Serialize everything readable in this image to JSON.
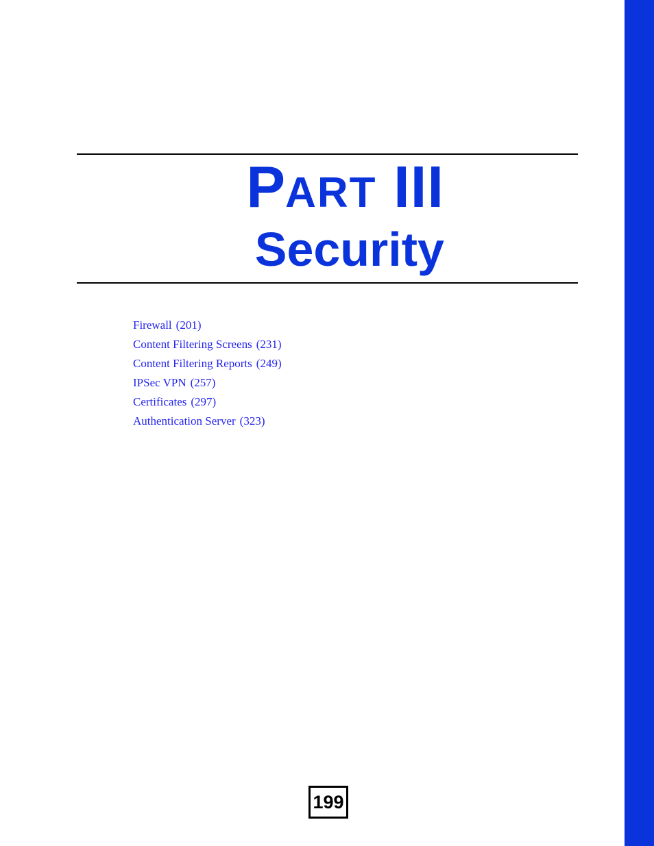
{
  "page": {
    "background_color": "#ffffff",
    "accent_color": "#0a33dc",
    "link_color": "#2424ee",
    "rule_color": "#000000",
    "number": "199"
  },
  "edge_bar": {
    "color": "#0a33dc"
  },
  "part": {
    "label_lead": "P",
    "label_rest": "ART",
    "number": "III",
    "title": "Security"
  },
  "chapters": [
    {
      "title": "Firewall",
      "page": "(201)"
    },
    {
      "title": "Content Filtering Screens",
      "page": "(231)"
    },
    {
      "title": "Content Filtering Reports",
      "page": "(249)"
    },
    {
      "title": "IPSec VPN",
      "page": "(257)"
    },
    {
      "title": "Certificates",
      "page": "(297)"
    },
    {
      "title": "Authentication Server",
      "page": "(323)"
    }
  ]
}
